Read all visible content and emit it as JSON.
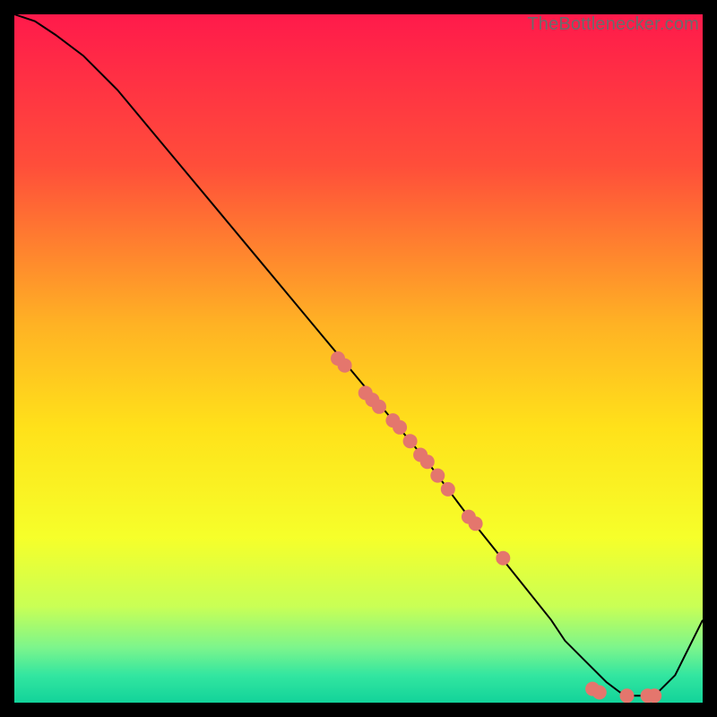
{
  "watermark": "TheBottlenecker.com",
  "chart_data": {
    "type": "line",
    "title": "",
    "xlabel": "",
    "ylabel": "",
    "xlim": [
      0,
      100
    ],
    "ylim": [
      0,
      100
    ],
    "background": {
      "type": "vertical-gradient",
      "stops": [
        {
          "y": 0,
          "color": "#ff1a4b"
        },
        {
          "y": 22,
          "color": "#ff4e3a"
        },
        {
          "y": 45,
          "color": "#ffb224"
        },
        {
          "y": 60,
          "color": "#ffe11a"
        },
        {
          "y": 76,
          "color": "#f6ff2a"
        },
        {
          "y": 86,
          "color": "#c9ff55"
        },
        {
          "y": 92,
          "color": "#7cf58c"
        },
        {
          "y": 96,
          "color": "#33e6a0"
        },
        {
          "y": 100,
          "color": "#12d39a"
        }
      ]
    },
    "series": [
      {
        "name": "bottleneck-curve",
        "color": "#000000",
        "stroke_width": 2,
        "x": [
          0,
          3,
          6,
          10,
          15,
          20,
          25,
          30,
          35,
          40,
          45,
          50,
          55,
          60,
          63,
          66,
          70,
          74,
          78,
          80,
          83,
          86,
          88,
          90,
          93,
          96,
          100
        ],
        "y": [
          100,
          99,
          97,
          94,
          89,
          83,
          77,
          71,
          65,
          59,
          53,
          47,
          41,
          35,
          31,
          27,
          22,
          17,
          12,
          9,
          6,
          3,
          1.5,
          1,
          1,
          4,
          12
        ]
      }
    ],
    "scatter": [
      {
        "name": "highlighted-points",
        "color": "#e4766d",
        "radius": 8,
        "points": [
          {
            "x": 47,
            "y": 50
          },
          {
            "x": 48,
            "y": 49
          },
          {
            "x": 51,
            "y": 45
          },
          {
            "x": 52,
            "y": 44
          },
          {
            "x": 53,
            "y": 43
          },
          {
            "x": 55,
            "y": 41
          },
          {
            "x": 56,
            "y": 40
          },
          {
            "x": 57.5,
            "y": 38
          },
          {
            "x": 59,
            "y": 36
          },
          {
            "x": 60,
            "y": 35
          },
          {
            "x": 61.5,
            "y": 33
          },
          {
            "x": 63,
            "y": 31
          },
          {
            "x": 66,
            "y": 27
          },
          {
            "x": 67,
            "y": 26
          },
          {
            "x": 71,
            "y": 21
          },
          {
            "x": 84,
            "y": 2
          },
          {
            "x": 85,
            "y": 1.5
          },
          {
            "x": 89,
            "y": 1
          },
          {
            "x": 92,
            "y": 1
          },
          {
            "x": 93,
            "y": 1
          }
        ]
      }
    ]
  }
}
